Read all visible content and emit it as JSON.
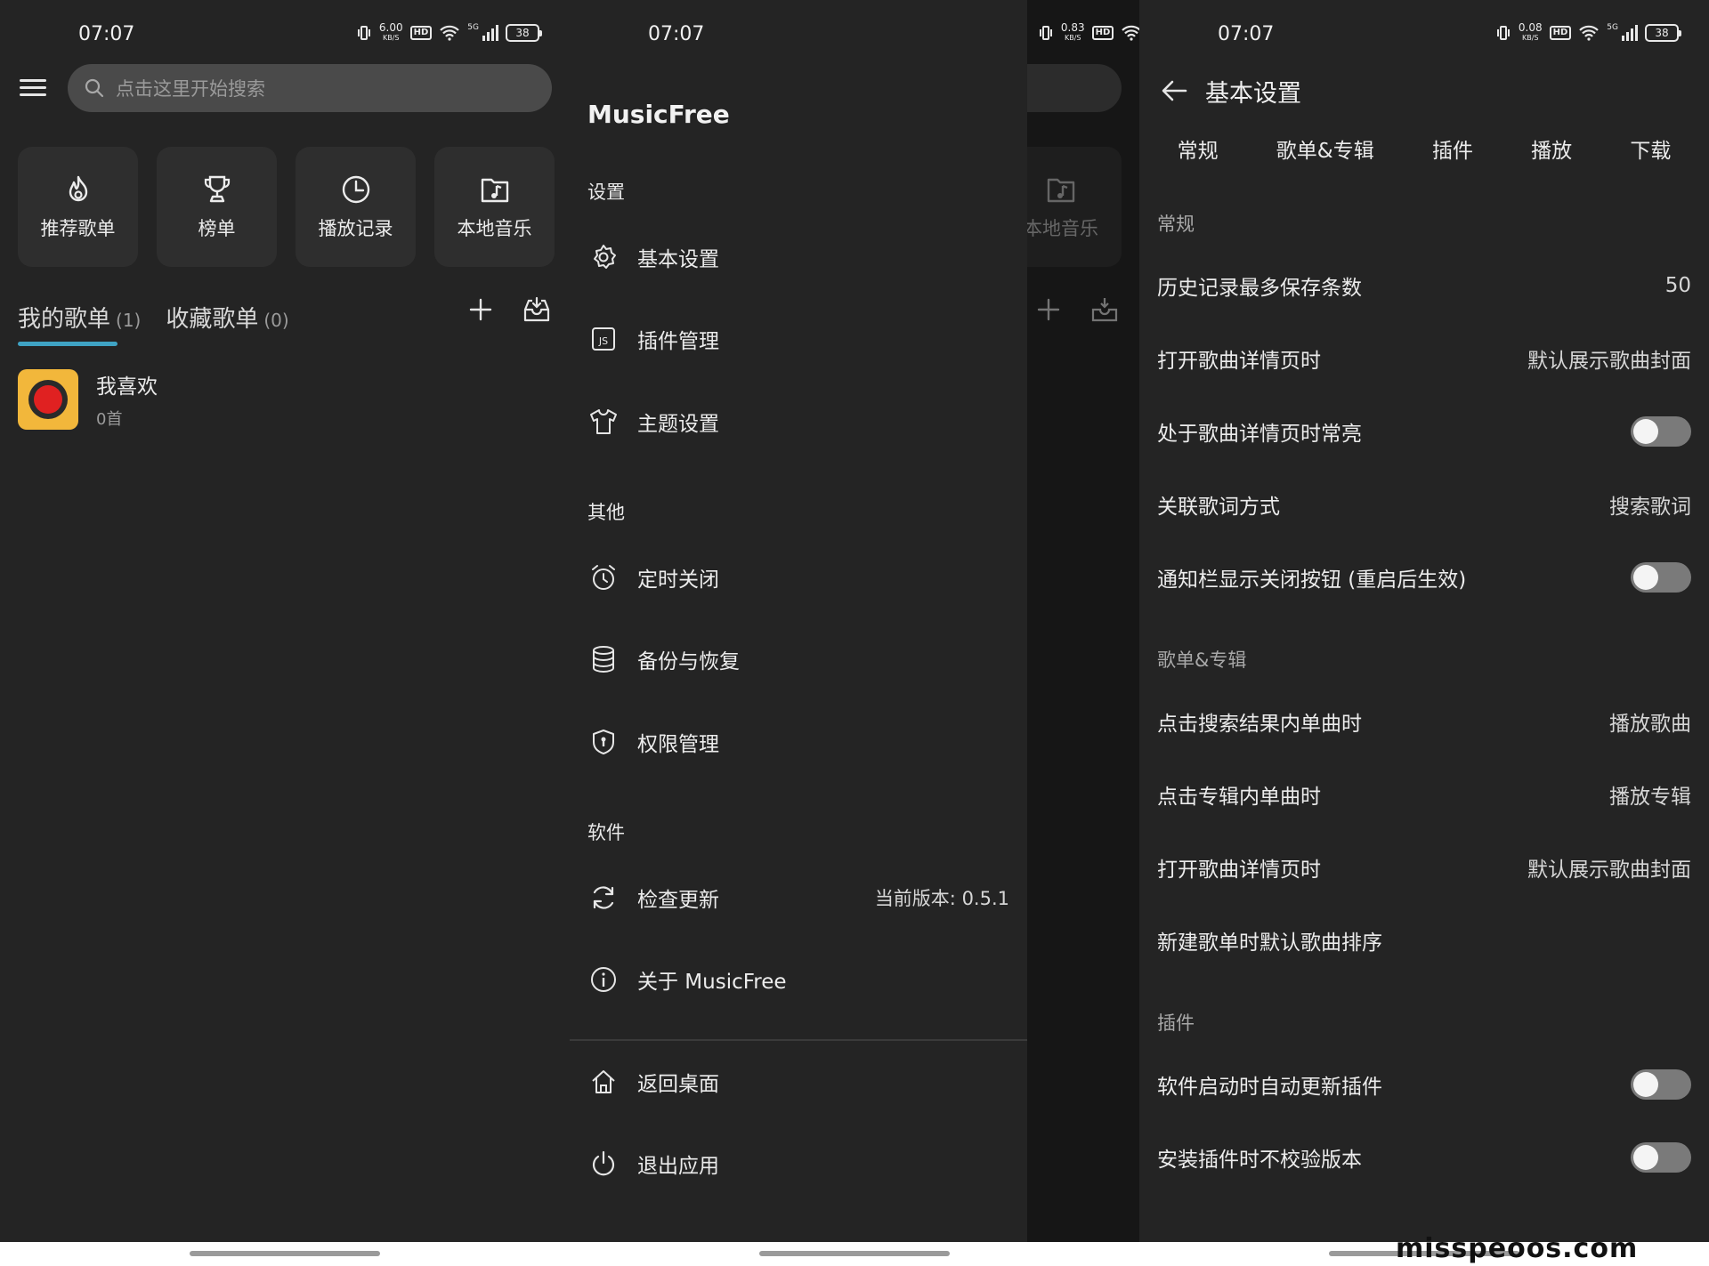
{
  "status_bars": [
    {
      "time": "07:07",
      "speed": "6.00",
      "speed_unit": "KB/S",
      "hd": "HD",
      "network": "5G",
      "battery": "38"
    },
    {
      "time": "07:07",
      "speed": "0.83",
      "speed_unit": "KB/S",
      "hd": "HD",
      "network": "5G",
      "battery": "38"
    },
    {
      "time": "07:07",
      "speed": "0.08",
      "speed_unit": "KB/S",
      "hd": "HD",
      "network": "5G",
      "battery": "38"
    }
  ],
  "home": {
    "search_placeholder": "点击这里开始搜索",
    "tiles": [
      {
        "label": "推荐歌单",
        "icon": "flame-icon"
      },
      {
        "label": "榜单",
        "icon": "trophy-icon"
      },
      {
        "label": "播放记录",
        "icon": "clock-icon"
      },
      {
        "label": "本地音乐",
        "icon": "music-folder-icon"
      }
    ],
    "tabs": [
      {
        "label": "我的歌单",
        "count": "(1)"
      },
      {
        "label": "收藏歌单",
        "count": "(0)"
      }
    ],
    "playlists": [
      {
        "title": "我喜欢",
        "subtitle": "0首"
      }
    ]
  },
  "drawer": {
    "app_title": "MusicFree",
    "sections": {
      "settings": "设置",
      "other": "其他",
      "software": "软件"
    },
    "items": {
      "basic_settings": "基本设置",
      "plugin_management": "插件管理",
      "theme_settings": "主题设置",
      "timer_close": "定时关闭",
      "backup_restore": "备份与恢复",
      "permissions": "权限管理",
      "check_update": "检查更新",
      "version": "当前版本: 0.5.1",
      "about": "关于 MusicFree",
      "back_home": "返回桌面",
      "exit_app": "退出应用"
    },
    "ghost_tile_label": "本地音乐"
  },
  "settings": {
    "title": "基本设置",
    "tabs": [
      "常规",
      "歌单&专辑",
      "插件",
      "播放",
      "下载"
    ],
    "groups": {
      "general": "常规",
      "playlist_album": "歌单&专辑",
      "plugin": "插件"
    },
    "rows": {
      "history_max": {
        "label": "历史记录最多保存条数",
        "value": "50"
      },
      "open_detail": {
        "label": "打开歌曲详情页时",
        "value": "默认展示歌曲封面"
      },
      "keep_awake": {
        "label": "处于歌曲详情页时常亮",
        "toggle": false
      },
      "lyric_mode": {
        "label": "关联歌词方式",
        "value": "搜索歌词"
      },
      "notif_close": {
        "label": "通知栏显示关闭按钮 (重启后生效)",
        "toggle": false
      },
      "click_search_song": {
        "label": "点击搜索结果内单曲时",
        "value": "播放歌曲"
      },
      "click_album_song": {
        "label": "点击专辑内单曲时",
        "value": "播放专辑"
      },
      "open_detail_2": {
        "label": "打开歌曲详情页时",
        "value": "默认展示歌曲封面"
      },
      "new_playlist_sort": {
        "label": "新建歌单时默认歌曲排序",
        "value": ""
      },
      "auto_update_plugin": {
        "label": "软件启动时自动更新插件",
        "toggle": false
      },
      "skip_version_check": {
        "label": "安装插件时不校验版本",
        "toggle": false
      }
    }
  },
  "watermark": "misspeoos.com",
  "colors": {
    "background": "#242424",
    "tab_accent": "#3fa3c4",
    "cover": "#f2b73b",
    "toggle_off": "#7a7a7a"
  }
}
